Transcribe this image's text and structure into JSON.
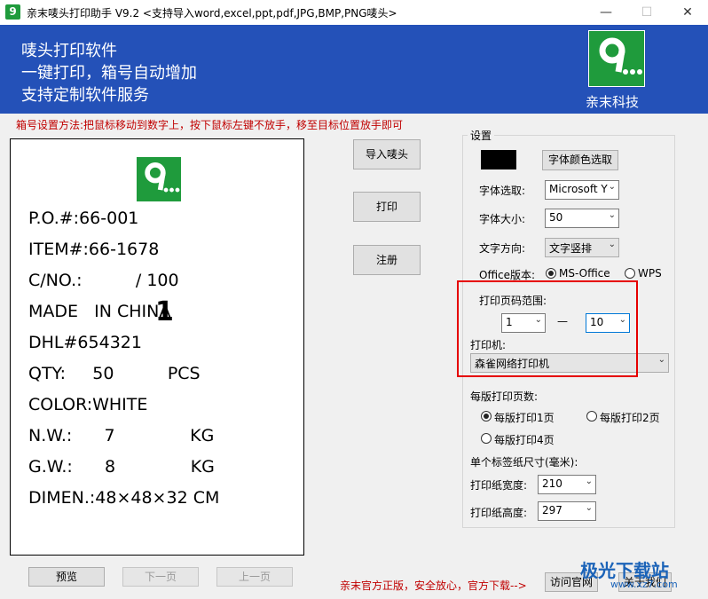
{
  "window": {
    "title": "亲末唛头打印助手   V9.2     <支持导入word,excel,ppt,pdf,JPG,BMP,PNG唛头>",
    "icon_text": "9",
    "controls": {
      "minimize": "—",
      "maximize": "☐",
      "close": "✕"
    }
  },
  "banner": {
    "lines": [
      "唛头打印软件",
      "一键打印，箱号自动增加",
      "支持定制软件服务"
    ],
    "logo_text": "9...",
    "company": "亲末科技",
    "color": "#2451b8"
  },
  "instruction": "箱号设置方法:把鼠标移动到数字上，按下鼠标左键不放手，移至目标位置放手即可",
  "preview": {
    "logo_text": "9...",
    "lines": [
      "P.O.#:66-001",
      "ITEM#:66-1678",
      "C/NO.:          / 100",
      "MADE   IN CHINA",
      "DHL#654321",
      "QTY:     50          PCS",
      "COLOR:WHITE",
      "N.W.:      7              KG",
      "G.W.:      8              KG",
      "DIMEN.:48×48×32 CM"
    ],
    "box_number": "1"
  },
  "actions": {
    "import": "导入唛头",
    "print": "打印",
    "register": "注册"
  },
  "settings": {
    "group_label": "设置",
    "color_swatch": "#000000",
    "color_button": "字体颜色选取",
    "font_label": "字体选取:",
    "font_value": "Microsoft Y",
    "size_label": "字体大小:",
    "size_value": "50",
    "direction_label": "文字方向:",
    "direction_value": "文字竖排",
    "office_label": "Office版本:",
    "office_options": [
      "MS-Office",
      "WPS"
    ],
    "office_selected": "MS-Office",
    "page_range_label": "打印页码范围:",
    "page_from": "1",
    "page_dash": "—",
    "page_to": "10",
    "printer_label": "打印机:",
    "printer_value": "森雀网络打印机",
    "per_page_label": "每版打印页数:",
    "per_page_options": [
      "每版打印1页",
      "每版打印2页",
      "每版打印4页"
    ],
    "per_page_selected": "每版打印1页",
    "label_size_label": "单个标签纸尺寸(毫米):",
    "width_label": "打印纸宽度:",
    "width_value": "210",
    "height_label": "打印纸高度:",
    "height_value": "297"
  },
  "bottom": {
    "preview": "预览",
    "next": "下一页",
    "prev": "上一页",
    "notice": "亲末官方正版，安全放心，官方下载-->",
    "visit": "访问官网",
    "about": "关于我们"
  },
  "watermark": {
    "brand": "极光下载站",
    "url": "www.xz7.com"
  }
}
